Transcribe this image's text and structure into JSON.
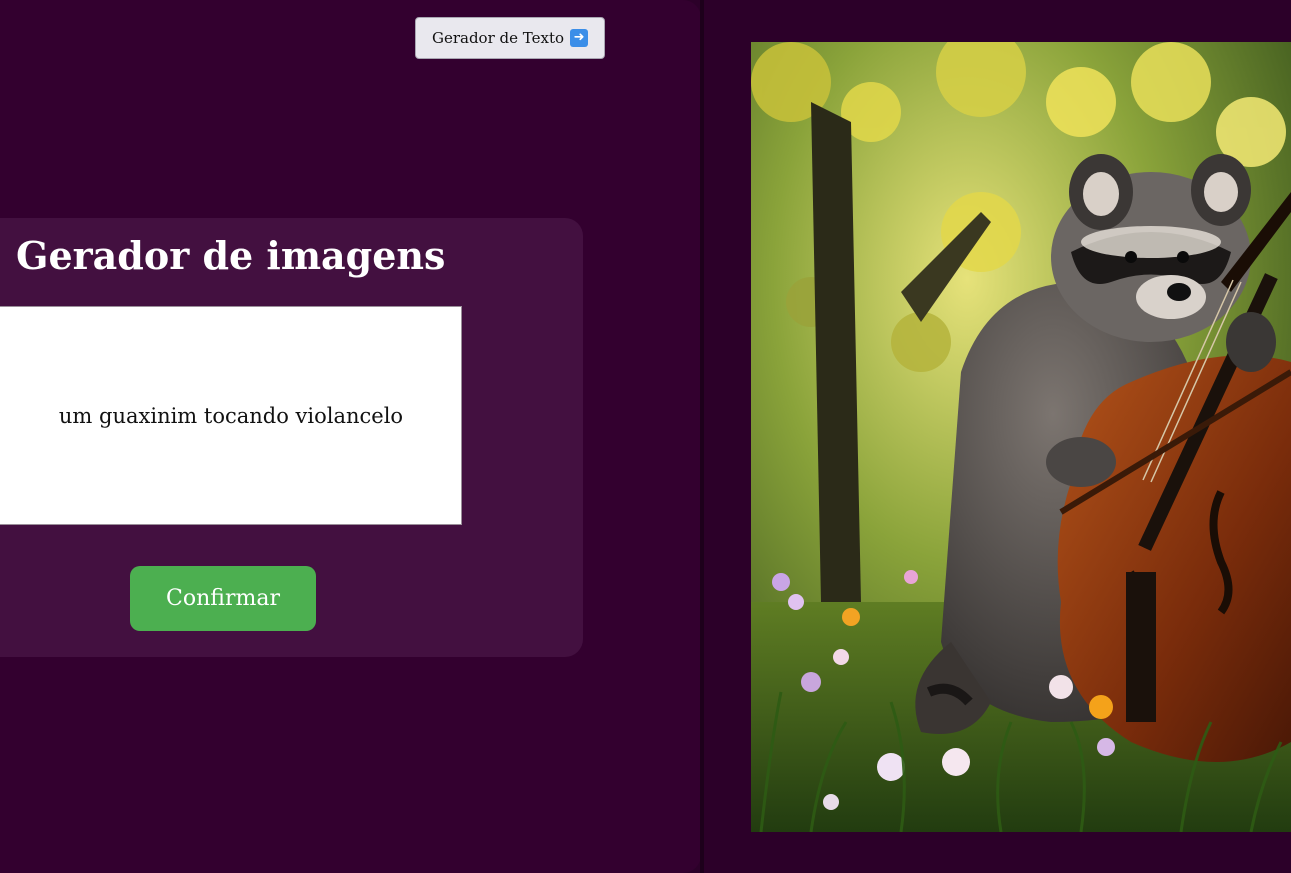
{
  "nav": {
    "button_label": "Gerador de Texto",
    "button_icon": "arrow-right-icon"
  },
  "generator": {
    "title": "Gerador de imagens",
    "prompt_value": "um guaxinim tocando violancelo",
    "confirm_label": "Confirmar"
  },
  "result_image": {
    "subject": "raccoon-playing-cello"
  },
  "colors": {
    "background": "#33002f",
    "card": "#431040",
    "confirm": "#4caf50",
    "nav_button": "#e9e8ee"
  }
}
